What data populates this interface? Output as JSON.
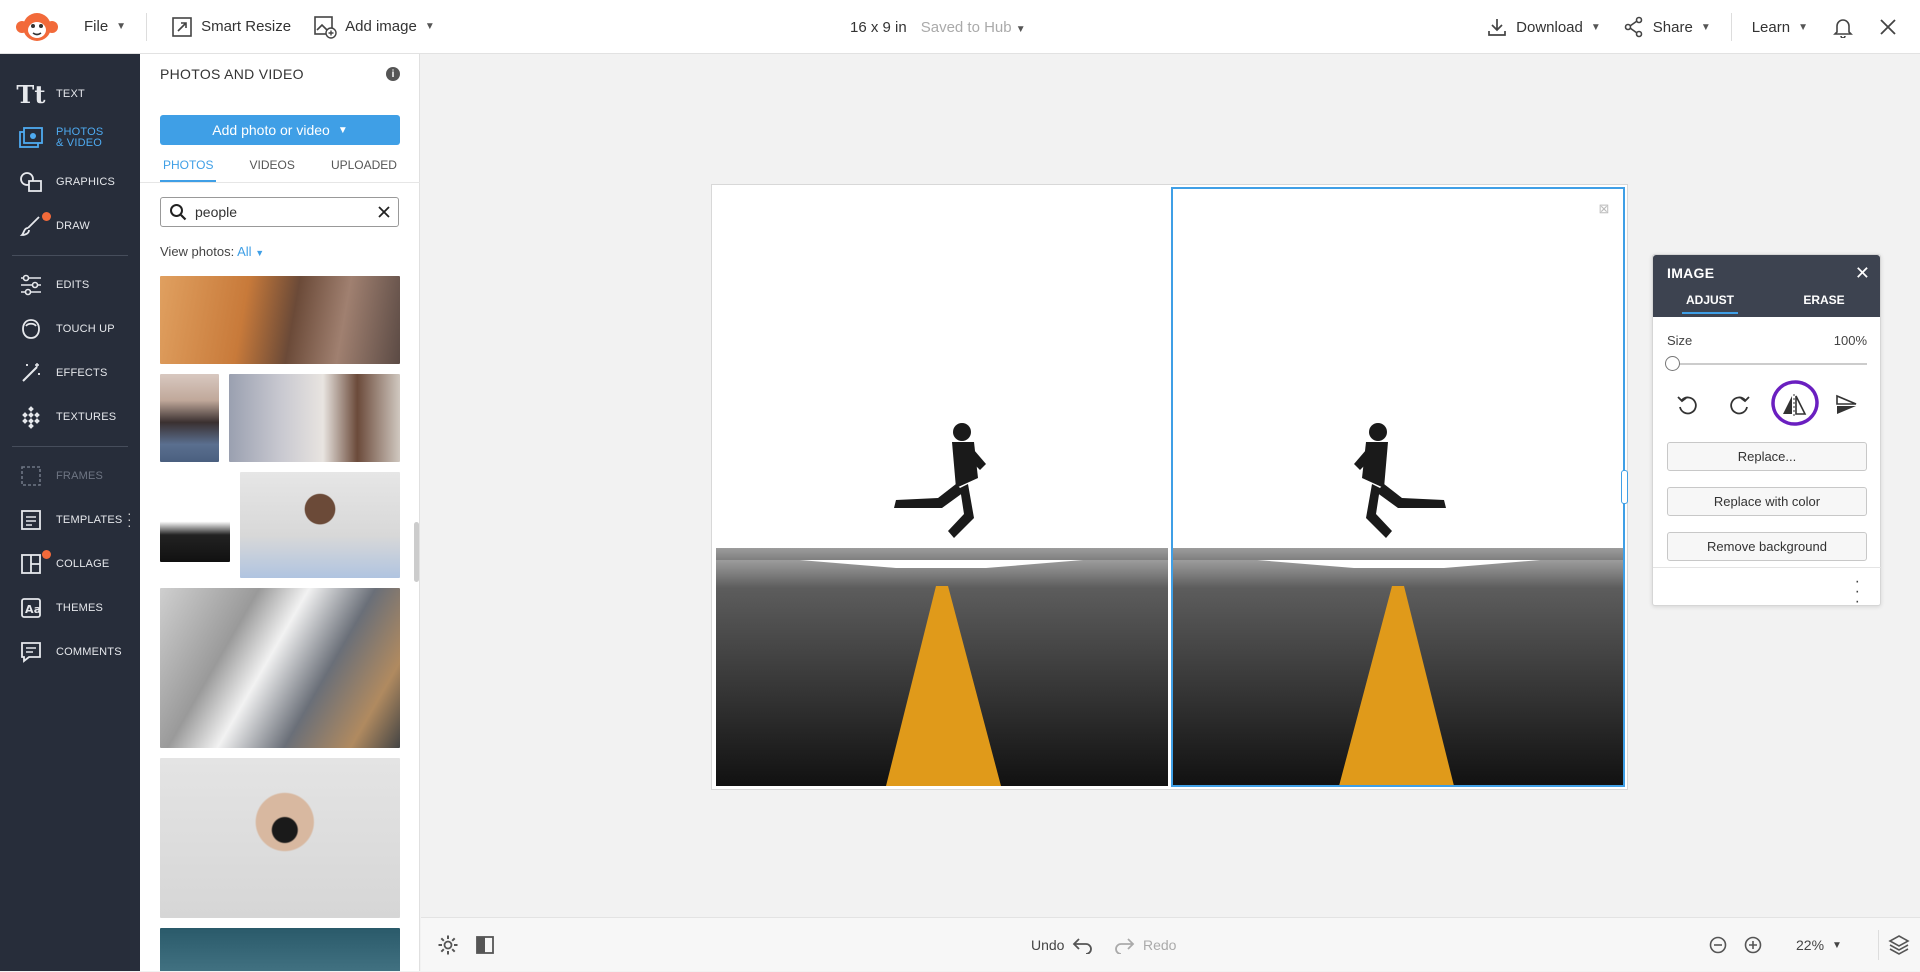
{
  "topbar": {
    "file_label": "File",
    "smart_resize_label": "Smart Resize",
    "add_image_label": "Add image",
    "doc_size": "16 x 9 in",
    "saved_status": "Saved to Hub",
    "download_label": "Download",
    "share_label": "Share",
    "learn_label": "Learn"
  },
  "rail": {
    "items": [
      {
        "label": "TEXT"
      },
      {
        "label": "PHOTOS",
        "label2": "& VIDEO"
      },
      {
        "label": "GRAPHICS"
      },
      {
        "label": "DRAW"
      },
      {
        "label": "EDITS"
      },
      {
        "label": "TOUCH UP"
      },
      {
        "label": "EFFECTS"
      },
      {
        "label": "TEXTURES"
      },
      {
        "label": "FRAMES"
      },
      {
        "label": "TEMPLATES"
      },
      {
        "label": "COLLAGE"
      },
      {
        "label": "THEMES"
      },
      {
        "label": "COMMENTS"
      }
    ]
  },
  "panel": {
    "title": "PHOTOS AND VIDEO",
    "add_button": "Add photo or video",
    "tabs": [
      "PHOTOS",
      "VIDEOS",
      "UPLOADED"
    ],
    "search_value": "people",
    "view_photos_label": "View photos:",
    "view_photos_value": "All"
  },
  "image_panel": {
    "title": "IMAGE",
    "tabs": [
      "ADJUST",
      "ERASE"
    ],
    "size_label": "Size",
    "size_value": "100%",
    "replace_button": "Replace...",
    "replace_color_button": "Replace with color",
    "remove_bg_button": "Remove background"
  },
  "bottombar": {
    "undo_label": "Undo",
    "redo_label": "Redo",
    "zoom_value": "22%"
  },
  "colors": {
    "accent": "#3f9fe6",
    "rail_bg": "#272d3a",
    "annotation": "#6a1fc0",
    "notify_dot": "#f26a3a"
  }
}
